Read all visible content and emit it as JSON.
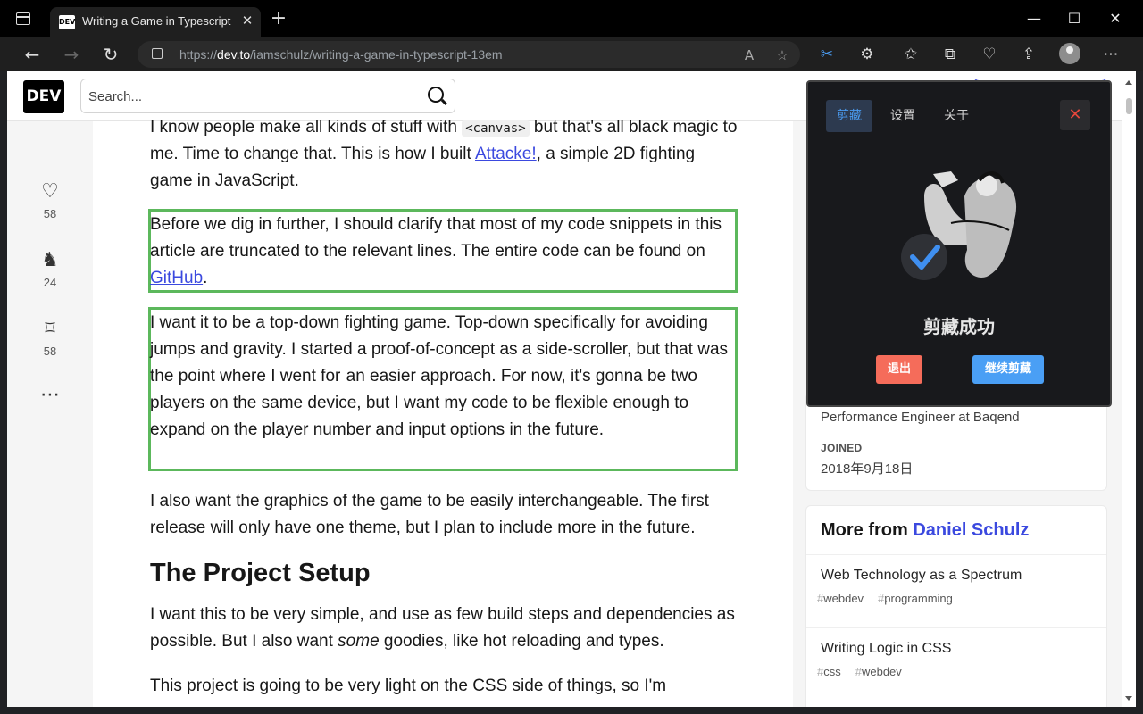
{
  "browser": {
    "tab_title": "Writing a Game in Typescript - D",
    "favicon_text": "DEV",
    "url_prefix": "https://",
    "url_domain": "dev.to",
    "url_path": "/iamschulz/writing-a-game-in-typescript-13em"
  },
  "header": {
    "logo": "DEV",
    "search_placeholder": "Search..."
  },
  "actions": [
    {
      "name": "heart-icon",
      "count": "58"
    },
    {
      "name": "unicorn-icon",
      "count": "24"
    },
    {
      "name": "bookmark-icon",
      "count": "58"
    }
  ],
  "article": {
    "p1_a": "I know people make all kinds of stuff with ",
    "p1_code": "<canvas>",
    "p1_b": " but that's all black magic to me. Time to change that. This is how I built ",
    "p1_link": "Attacke!",
    "p1_c": ", a simple 2D fighting game in JavaScript.",
    "p2_a": "Before we dig in further, I should clarify that most of my code snippets in this article are truncated to the relevant lines. The entire code can be found on ",
    "p2_link": "GitHub",
    "p2_b": ".",
    "p3_a": "I want it to be a top-down fighting game. Top-down specifically for avoiding jumps and gravity. I started a proof-of-concept as a side-scroller, but that was the point where I went for ",
    "p3_b": "an easier approach. For now, it's gonna be two players on the same device, but I want my code to be flexible enough to expand on the player number and input options in the future.",
    "p4": "I also want the graphics of the game to be easily interchangeable. The first release will only have one theme, but I plan to include more in the future.",
    "h2": "The Project Setup",
    "p5_a": "I want this to be very simple, and use as few build steps and dependencies as possible. But I also want ",
    "p5_em": "some",
    "p5_b": " goodies, like hot reloading and types.",
    "p6": "This project is going to be very light on the CSS side of things, so I'm"
  },
  "sidebar": {
    "work": "Performance Engineer at Baqend",
    "joined_label": "JOINED",
    "joined_date": "2018年9月18日",
    "more_from": "More from",
    "author": "Daniel Schulz",
    "posts": [
      {
        "title": "Web Technology as a Spectrum",
        "tags": [
          "webdev",
          "programming"
        ]
      },
      {
        "title": "Writing Logic in CSS",
        "tags": [
          "css",
          "webdev"
        ]
      }
    ]
  },
  "popup": {
    "tabs": [
      "剪藏",
      "设置",
      "关于"
    ],
    "close": "✕",
    "title": "剪藏成功",
    "exit_button": "退出",
    "continue_button": "继续剪藏",
    "accent": "#4a9bf0",
    "exit_color": "#f56c5a",
    "continue_color": "#4a9ff5"
  }
}
